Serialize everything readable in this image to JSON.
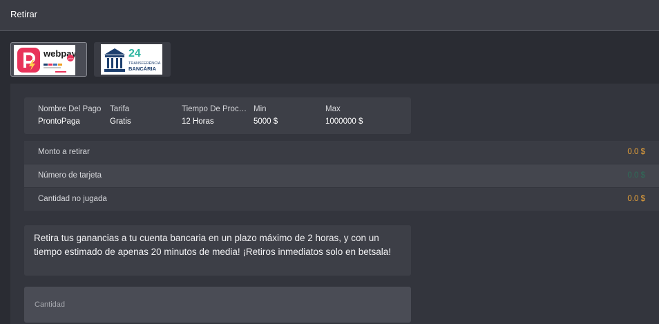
{
  "header": {
    "title": "Retirar"
  },
  "methods": [
    {
      "name": "webpay plus",
      "logo_text": "webpay",
      "logo_sub": "plus",
      "selected": true
    },
    {
      "name": "24 Transferencia Bancaria",
      "logo_num": "24",
      "logo_line1": "TRANSFERÊNCIA",
      "logo_line2": "BANCÁRIA",
      "selected": false
    }
  ],
  "info": {
    "columns": [
      {
        "label": "Nombre Del Pago",
        "value": "ProntoPaga"
      },
      {
        "label": "Tarifa",
        "value": "Gratis"
      },
      {
        "label": "Tiempo De Procesamiento",
        "value": "12 Horas"
      },
      {
        "label": "Min",
        "value": "5000 $"
      },
      {
        "label": "Max",
        "value": "1000000 $"
      }
    ]
  },
  "rows": [
    {
      "label": "Monto a retirar",
      "value": "0.0 $",
      "color": "#e8a23a"
    },
    {
      "label": "Número de tarjeta",
      "value": "0.0 $",
      "color": "#2f6b58"
    },
    {
      "label": "Cantidad no jugada",
      "value": "0.0 $",
      "color": "#e8a23a"
    }
  ],
  "note": {
    "text": "Retira tus ganancias a tu cuenta bancaria en un plazo máximo de 2 horas, y con un tiempo estimado de apenas 20 minutos de media! ¡Retiros inmediatos solo en betsala!"
  },
  "amount_input": {
    "placeholder": "Cantidad",
    "value": ""
  },
  "colors": {
    "accent_value": "#e8a23a",
    "muted_value": "#2f6b58",
    "webpay_pink": "#e8335a",
    "bank_navy": "#1d3f6e"
  }
}
